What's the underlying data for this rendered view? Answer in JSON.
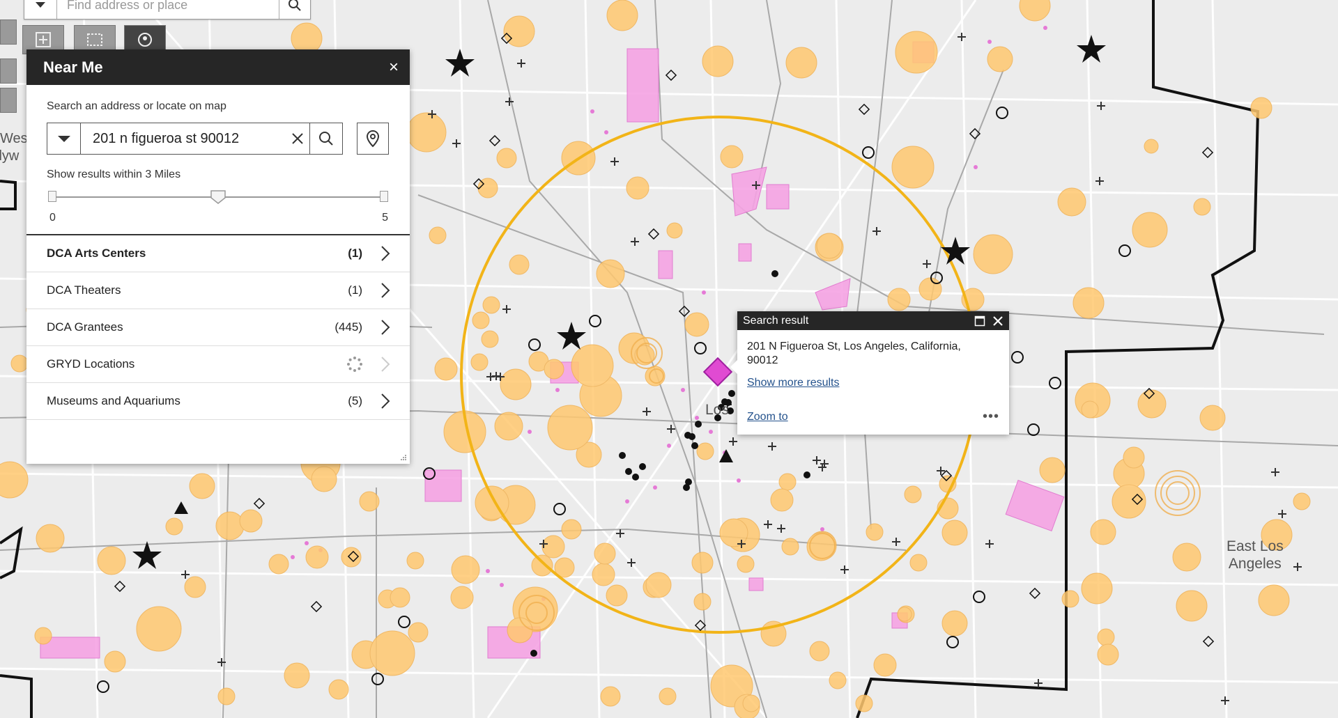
{
  "topbar": {
    "search_placeholder": "Find address or place"
  },
  "panel": {
    "title": "Near Me",
    "close": "×",
    "hint": "Search an address or locate on map",
    "search_value": "201 n figueroa st 90012",
    "within_text": "Show results within 3 Miles",
    "slider": {
      "min": "0",
      "max": "5",
      "value": 3
    },
    "results": [
      {
        "name": "DCA Arts Centers",
        "count": "(1)",
        "bold": true
      },
      {
        "name": "DCA Theaters",
        "count": "(1)",
        "bold": false
      },
      {
        "name": "DCA Grantees",
        "count": "(445)",
        "bold": false
      },
      {
        "name": "GRYD Locations",
        "count": "",
        "loading": true
      },
      {
        "name": "Museums and Aquariums",
        "count": "(5)",
        "bold": false
      }
    ]
  },
  "popup": {
    "title": "Search result",
    "address_line1": "201 N Figueroa St, Los Angeles, California,",
    "address_line2": "90012",
    "show_more": "Show more results",
    "zoom_to": "Zoom to",
    "more": "•••"
  },
  "map_labels": {
    "east_la_line1": "East Los",
    "east_la_line2": "Angeles",
    "los": "Los",
    "wes": "Wes",
    "lyw": "llyw"
  },
  "colors": {
    "circle_fill": "#ffc870",
    "park_fill": "#f5a3e4",
    "radius_ring": "#f2b418",
    "boundary": "#111111",
    "panel_header": "#262626",
    "link": "#24528c"
  }
}
